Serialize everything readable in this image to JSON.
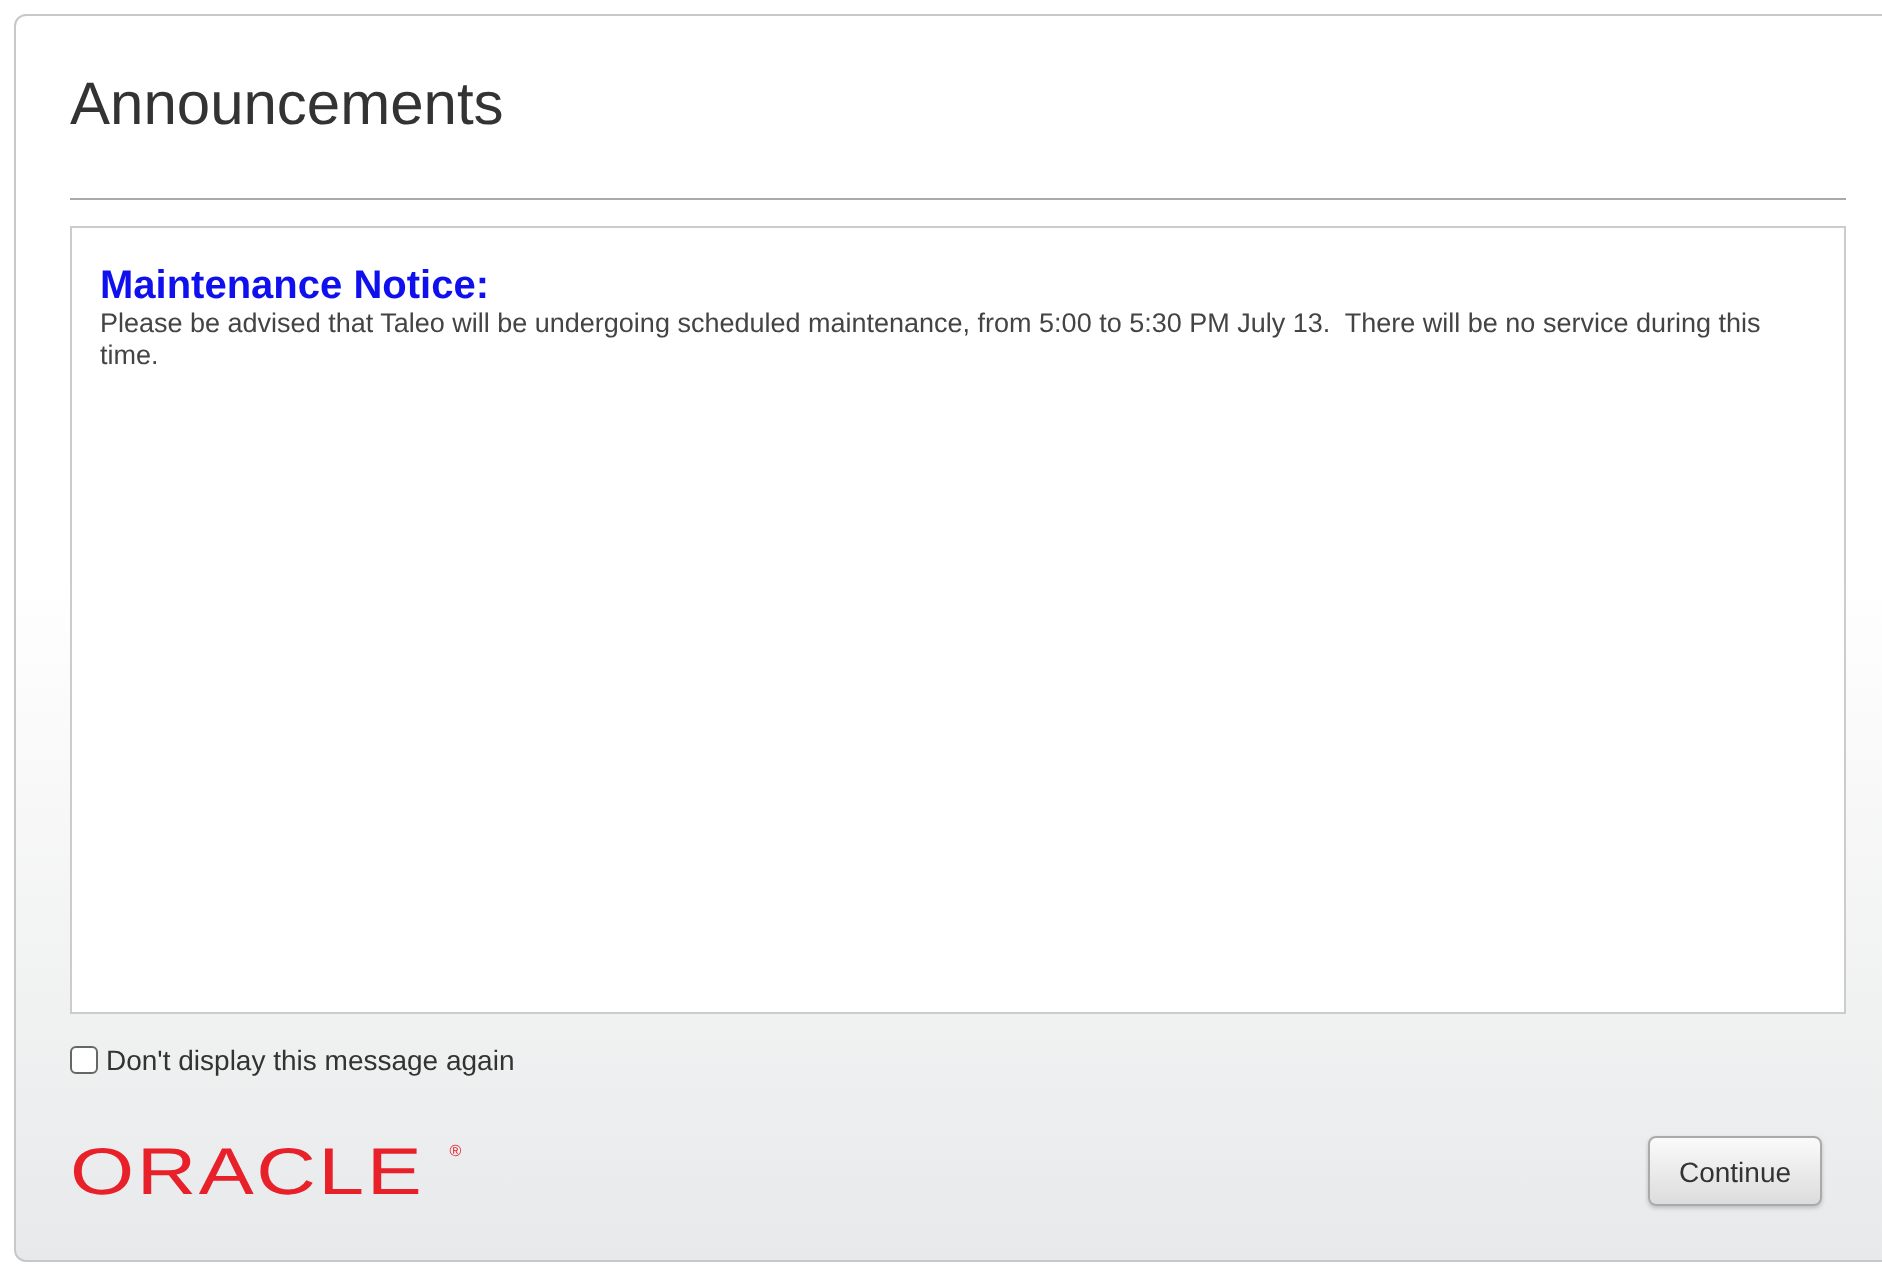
{
  "dialog": {
    "title": "Announcements",
    "message": {
      "heading": "Maintenance Notice:",
      "body": "Please be advised that Taleo will be undergoing scheduled maintenance, from 5:00 to 5:30 PM July 13.  There will be no service during this time."
    },
    "option": {
      "label": "Don't display this message again",
      "checked": false
    },
    "logo": {
      "text": "ORACLE",
      "mark": "®"
    },
    "buttons": [
      "Continue"
    ]
  }
}
